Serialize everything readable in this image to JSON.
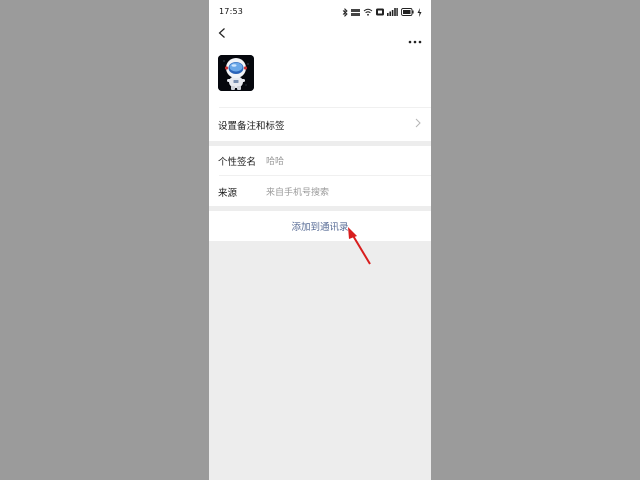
{
  "status_bar": {
    "time": "17:53",
    "battery_label": "100"
  },
  "header": {
    "back_icon": "chevron-left-icon",
    "more_icon": "more-dots-icon"
  },
  "profile": {
    "avatar_icon": "astronaut-avatar"
  },
  "remark_row": {
    "label": "设置备注和标签",
    "icon": "chevron-right-icon"
  },
  "info_rows": [
    {
      "label": "个性签名",
      "value": "哈哈"
    },
    {
      "label": "来源",
      "value": "来自手机号搜索"
    }
  ],
  "action": {
    "label": "添加到通讯录"
  },
  "annotation": {
    "icon": "red-arrow-icon",
    "color": "#d81e1e"
  },
  "colors": {
    "link": "#576b95",
    "background": "#ededed",
    "outer": "#9b9b9b"
  }
}
